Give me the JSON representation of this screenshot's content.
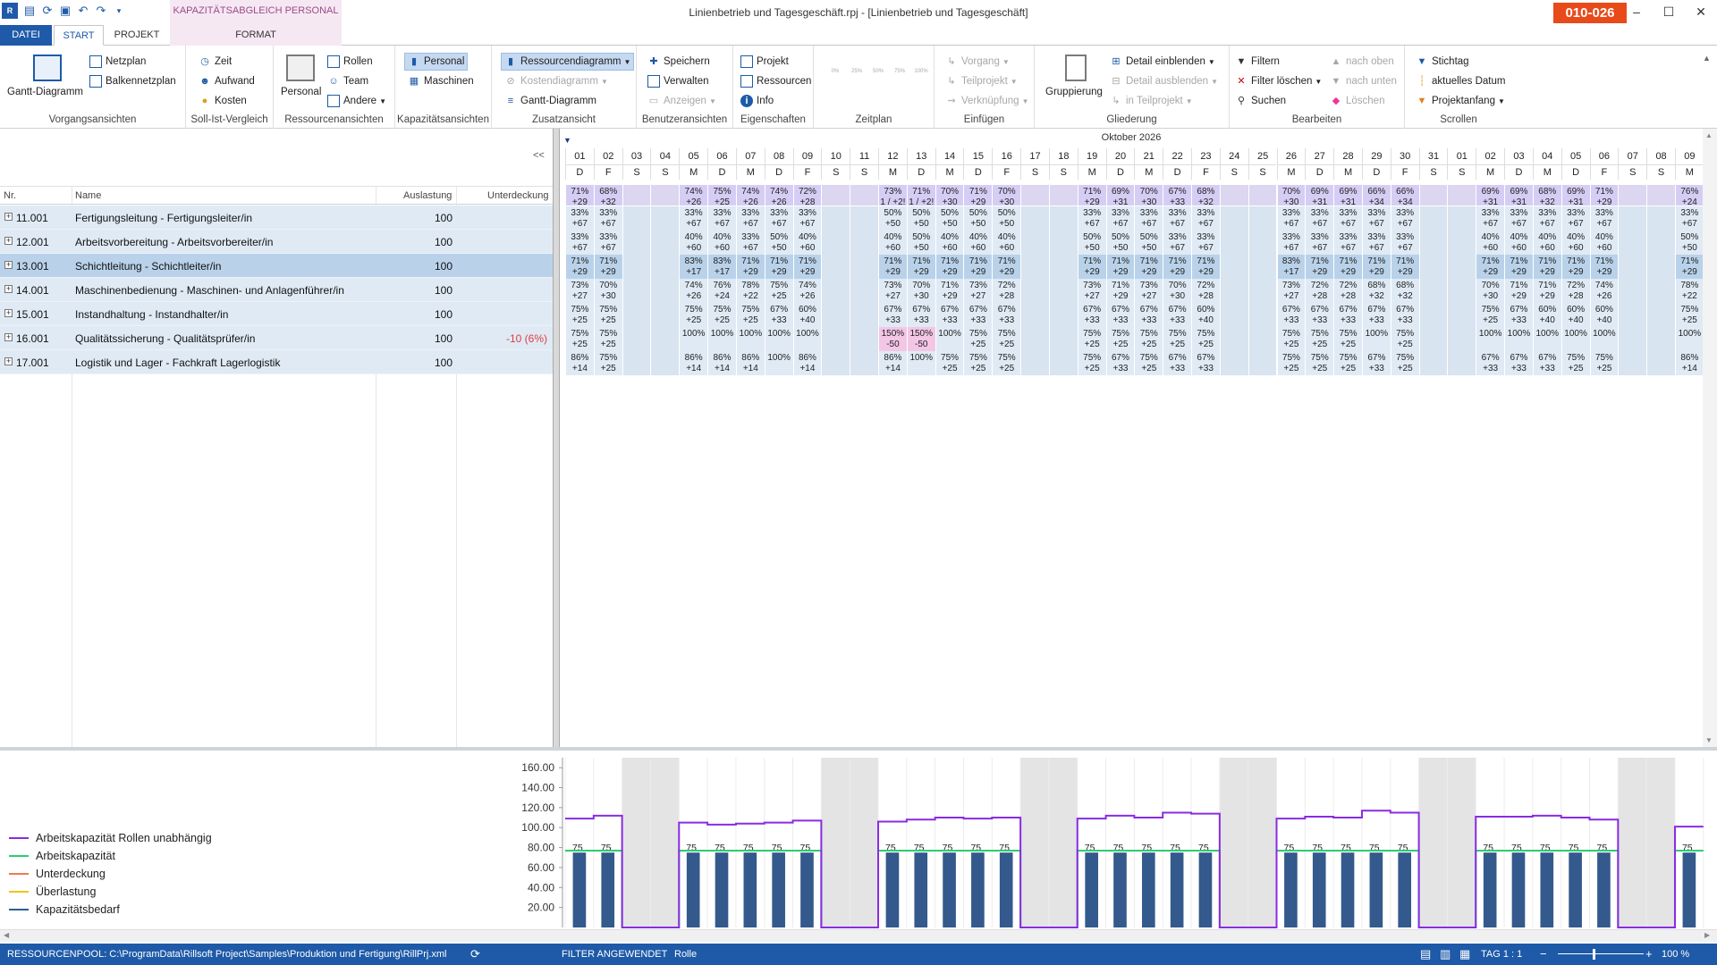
{
  "titlebar": {
    "document_title": "Linienbetrieb und Tagesgeschäft.rpj - [Linienbetrieb und Tagesgeschäft]",
    "badge": "010-026",
    "context_tab_label": "KAPAZITÄTSABGLEICH PERSONAL",
    "minimize": "–",
    "maximize": "☐",
    "close": "✕"
  },
  "tabs": [
    "DATEI",
    "START",
    "PROJEKT",
    "FORMAT"
  ],
  "ribbon": {
    "groups": [
      {
        "label": "Vorgangsansichten",
        "items": [
          "Gantt-Diagramm",
          "Netzplan",
          "Balkennetzplan"
        ]
      },
      {
        "label": "Soll-Ist-Vergleich",
        "items": [
          "Zeit",
          "Aufwand",
          "Kosten"
        ]
      },
      {
        "label": "Ressourcenansichten",
        "items": [
          "Personal",
          "Rollen",
          "Team",
          "Andere"
        ]
      },
      {
        "label": "Kapazitätsansichten",
        "items": [
          "Personal",
          "Maschinen"
        ]
      },
      {
        "label": "Zusatzansicht",
        "items": [
          "Ressourcendiagramm",
          "Kostendiagramm",
          "Gantt-Diagramm"
        ]
      },
      {
        "label": "Benutzeransichten",
        "items": [
          "Speichern",
          "Verwalten",
          "Anzeigen"
        ]
      },
      {
        "label": "Eigenschaften",
        "items": [
          "Projekt",
          "Ressourcen",
          "Info"
        ]
      },
      {
        "label": "Zeitplan",
        "items": [
          "0%",
          "25%",
          "50%",
          "75%",
          "100%"
        ]
      },
      {
        "label": "Einfügen",
        "items": [
          "Vorgang",
          "Teilprojekt",
          "Verknüpfung"
        ]
      },
      {
        "label": "Gliederung",
        "items": [
          "Gruppierung",
          "Detail einblenden",
          "Detail ausblenden",
          "in Teilprojekt"
        ]
      },
      {
        "label": "Bearbeiten",
        "items": [
          "Filtern",
          "Filter löschen",
          "Suchen",
          "nach oben",
          "nach unten",
          "Löschen"
        ]
      },
      {
        "label": "Scrollen",
        "items": [
          "Stichtag",
          "aktuelles Datum",
          "Projektanfang"
        ]
      }
    ]
  },
  "table": {
    "collapse_label": "<<",
    "headers": {
      "nr": "Nr.",
      "name": "Name",
      "auslastung": "Auslastung",
      "unterdeckung": "Unterdeckung"
    },
    "rows": [
      {
        "nr": "11.001",
        "name": "Fertigungsleitung - Fertigungsleiter/in",
        "auslastung": "100",
        "unterdeckung": ""
      },
      {
        "nr": "12.001",
        "name": "Arbeitsvorbereitung - Arbeitsvorbereiter/in",
        "auslastung": "100",
        "unterdeckung": ""
      },
      {
        "nr": "13.001",
        "name": "Schichtleitung - Schichtleiter/in",
        "auslastung": "100",
        "unterdeckung": ""
      },
      {
        "nr": "14.001",
        "name": "Maschinenbedienung - Maschinen- und Anlagenführer/in",
        "auslastung": "100",
        "unterdeckung": ""
      },
      {
        "nr": "15.001",
        "name": "Instandhaltung - Instandhalter/in",
        "auslastung": "100",
        "unterdeckung": ""
      },
      {
        "nr": "16.001",
        "name": "Qualitätssicherung - Qualitätsprüfer/in",
        "auslastung": "100",
        "unterdeckung": "-10 (6%)"
      },
      {
        "nr": "17.001",
        "name": "Logistik und Lager - Fachkraft Lagerlogistik",
        "auslastung": "100",
        "unterdeckung": ""
      }
    ]
  },
  "calendar": {
    "month": "Oktober 2026",
    "days": [
      "01",
      "02",
      "03",
      "04",
      "05",
      "06",
      "07",
      "08",
      "09",
      "10",
      "11",
      "12",
      "13",
      "14",
      "15",
      "16",
      "17",
      "18",
      "19",
      "20",
      "21",
      "22",
      "23",
      "24",
      "25",
      "26",
      "27",
      "28",
      "29",
      "30",
      "31",
      "01",
      "02",
      "03",
      "04",
      "05",
      "06",
      "07",
      "08",
      "09"
    ],
    "weekdays": [
      "D",
      "F",
      "S",
      "S",
      "M",
      "D",
      "M",
      "D",
      "F",
      "S",
      "S",
      "M",
      "D",
      "M",
      "D",
      "F",
      "S",
      "S",
      "M",
      "D",
      "M",
      "D",
      "F",
      "S",
      "S",
      "M",
      "D",
      "M",
      "D",
      "F",
      "S",
      "S",
      "M",
      "D",
      "M",
      "D",
      "F",
      "S",
      "S",
      "M"
    ],
    "total": [
      "71%|+29",
      "68%|+32",
      "",
      "",
      "74%|+26",
      "75%|+25",
      "74%|+26",
      "74%|+26",
      "72%|+28",
      "",
      "",
      "73%|1 / +2!",
      "71%|1 / +2!",
      "70%|+30",
      "71%|+29",
      "70%|+30",
      "",
      "",
      "71%|+29",
      "69%|+31",
      "70%|+30",
      "67%|+33",
      "68%|+32",
      "",
      "",
      "70%|+30",
      "69%|+31",
      "69%|+31",
      "66%|+34",
      "66%|+34",
      "",
      "",
      "69%|+31",
      "69%|+31",
      "68%|+32",
      "69%|+31",
      "71%|+29",
      "",
      "",
      "76%|+24"
    ],
    "rows": [
      [
        "33%|+67",
        "33%|+67",
        "",
        "",
        "33%|+67",
        "33%|+67",
        "33%|+67",
        "33%|+67",
        "33%|+67",
        "",
        "",
        "50%|+50",
        "50%|+50",
        "50%|+50",
        "50%|+50",
        "50%|+50",
        "",
        "",
        "33%|+67",
        "33%|+67",
        "33%|+67",
        "33%|+67",
        "33%|+67",
        "",
        "",
        "33%|+67",
        "33%|+67",
        "33%|+67",
        "33%|+67",
        "33%|+67",
        "",
        "",
        "33%|+67",
        "33%|+67",
        "33%|+67",
        "33%|+67",
        "33%|+67",
        "",
        "",
        "33%|+67"
      ],
      [
        "33%|+67",
        "33%|+67",
        "",
        "",
        "40%|+60",
        "40%|+60",
        "33%|+67",
        "50%|+50",
        "40%|+60",
        "",
        "",
        "40%|+60",
        "50%|+50",
        "40%|+60",
        "40%|+60",
        "40%|+60",
        "",
        "",
        "50%|+50",
        "50%|+50",
        "50%|+50",
        "33%|+67",
        "33%|+67",
        "",
        "",
        "33%|+67",
        "33%|+67",
        "33%|+67",
        "33%|+67",
        "33%|+67",
        "",
        "",
        "40%|+60",
        "40%|+60",
        "40%|+60",
        "40%|+60",
        "40%|+60",
        "",
        "",
        "50%|+50"
      ],
      [
        "71%|+29",
        "71%|+29",
        "",
        "",
        "83%|+17",
        "83%|+17",
        "71%|+29",
        "71%|+29",
        "71%|+29",
        "",
        "",
        "71%|+29",
        "71%|+29",
        "71%|+29",
        "71%|+29",
        "71%|+29",
        "",
        "",
        "71%|+29",
        "71%|+29",
        "71%|+29",
        "71%|+29",
        "71%|+29",
        "",
        "",
        "83%|+17",
        "71%|+29",
        "71%|+29",
        "71%|+29",
        "71%|+29",
        "",
        "",
        "71%|+29",
        "71%|+29",
        "71%|+29",
        "71%|+29",
        "71%|+29",
        "",
        "",
        "71%|+29"
      ],
      [
        "73%|+27",
        "70%|+30",
        "",
        "",
        "74%|+26",
        "76%|+24",
        "78%|+22",
        "75%|+25",
        "74%|+26",
        "",
        "",
        "73%|+27",
        "70%|+30",
        "71%|+29",
        "73%|+27",
        "72%|+28",
        "",
        "",
        "73%|+27",
        "71%|+29",
        "73%|+27",
        "70%|+30",
        "72%|+28",
        "",
        "",
        "73%|+27",
        "72%|+28",
        "72%|+28",
        "68%|+32",
        "68%|+32",
        "",
        "",
        "70%|+30",
        "71%|+29",
        "71%|+29",
        "72%|+28",
        "74%|+26",
        "",
        "",
        "78%|+22"
      ],
      [
        "75%|+25",
        "75%|+25",
        "",
        "",
        "75%|+25",
        "75%|+25",
        "75%|+25",
        "67%|+33",
        "60%|+40",
        "",
        "",
        "67%|+33",
        "67%|+33",
        "67%|+33",
        "67%|+33",
        "67%|+33",
        "",
        "",
        "67%|+33",
        "67%|+33",
        "67%|+33",
        "67%|+33",
        "60%|+40",
        "",
        "",
        "67%|+33",
        "67%|+33",
        "67%|+33",
        "67%|+33",
        "67%|+33",
        "",
        "",
        "75%|+25",
        "67%|+33",
        "60%|+40",
        "60%|+40",
        "60%|+40",
        "",
        "",
        "75%|+25"
      ],
      [
        "75%|+25",
        "75%|+25",
        "",
        "",
        "100%",
        "100%",
        "100%",
        "100%",
        "100%",
        "",
        "",
        "150%|-50",
        "150%|-50",
        "100%",
        "75%|+25",
        "75%|+25",
        "",
        "",
        "75%|+25",
        "75%|+25",
        "75%|+25",
        "75%|+25",
        "75%|+25",
        "",
        "",
        "75%|+25",
        "75%|+25",
        "75%|+25",
        "100%",
        "75%|+25",
        "",
        "",
        "100%",
        "100%",
        "100%",
        "100%",
        "100%",
        "",
        "",
        "100%"
      ],
      [
        "86%|+14",
        "75%|+25",
        "",
        "",
        "86%|+14",
        "86%|+14",
        "86%|+14",
        "100%",
        "86%|+14",
        "",
        "",
        "86%|+14",
        "100%",
        "75%|+25",
        "75%|+25",
        "75%|+25",
        "",
        "",
        "75%|+25",
        "67%|+33",
        "75%|+25",
        "67%|+33",
        "67%|+33",
        "",
        "",
        "75%|+25",
        "75%|+25",
        "75%|+25",
        "67%|+33",
        "75%|+25",
        "",
        "",
        "67%|+33",
        "67%|+33",
        "67%|+33",
        "75%|+25",
        "75%|+25",
        "",
        "",
        "86%|+14"
      ]
    ]
  },
  "chart_data": {
    "type": "bar",
    "yticks": [
      "160.00",
      "140.00",
      "120.00",
      "100.00",
      "80.00",
      "60.00",
      "40.00",
      "20.00"
    ],
    "ylim": [
      0,
      170
    ],
    "weekend_indices": [
      2,
      3,
      9,
      10,
      16,
      17,
      23,
      24,
      30,
      31,
      37,
      38
    ],
    "capacity_independent": [
      109,
      112,
      0,
      0,
      105,
      103,
      104,
      105,
      107,
      0,
      0,
      106,
      108,
      110,
      109,
      110,
      0,
      0,
      109,
      112,
      110,
      115,
      114,
      0,
      0,
      109,
      111,
      110,
      117,
      115,
      0,
      0,
      111,
      111,
      112,
      110,
      108,
      0,
      0,
      101
    ],
    "capacity": [
      77,
      77,
      0,
      0,
      77,
      77,
      77,
      77,
      77,
      0,
      0,
      77,
      77,
      77,
      77,
      77,
      0,
      0,
      77,
      77,
      77,
      77,
      77,
      0,
      0,
      77,
      77,
      77,
      77,
      77,
      0,
      0,
      77,
      77,
      77,
      77,
      77,
      0,
      0,
      77
    ],
    "demand": [
      75,
      75,
      0,
      0,
      75,
      75,
      75,
      75,
      75,
      0,
      0,
      75,
      75,
      75,
      75,
      75,
      0,
      0,
      75,
      75,
      75,
      75,
      75,
      0,
      0,
      75,
      75,
      75,
      75,
      75,
      0,
      0,
      75,
      75,
      75,
      75,
      75,
      0,
      0,
      75
    ],
    "bar_labels": [
      "75",
      "75",
      "",
      "",
      "75",
      "75",
      "75",
      "75",
      "75",
      "",
      "",
      "75",
      "75",
      "75",
      "75",
      "75",
      "",
      "",
      "75",
      "75",
      "75",
      "75",
      "75",
      "",
      "",
      "75",
      "75",
      "75",
      "75",
      "75",
      "",
      "",
      "75",
      "75",
      "75",
      "75",
      "75",
      "",
      "",
      "75"
    ],
    "legend": [
      {
        "label": "Arbeitskapazität Rollen unabhängig",
        "color": "#8a2be2"
      },
      {
        "label": "Arbeitskapazität",
        "color": "#2ecc71"
      },
      {
        "label": "Unterdeckung",
        "color": "#f07a50"
      },
      {
        "label": "Überlastung",
        "color": "#f0c419"
      },
      {
        "label": "Kapazitätsbedarf",
        "color": "#2f5d8f"
      }
    ]
  },
  "statusbar": {
    "pool": "RESSOURCENPOOL: C:\\ProgramData\\Rillsoft Project\\Samples\\Produktion und Fertigung\\RillPrj.xml",
    "filter": "FILTER ANGEWENDET",
    "role": "Rolle",
    "scale": "TAG 1 : 1",
    "zoom": "100 %"
  }
}
